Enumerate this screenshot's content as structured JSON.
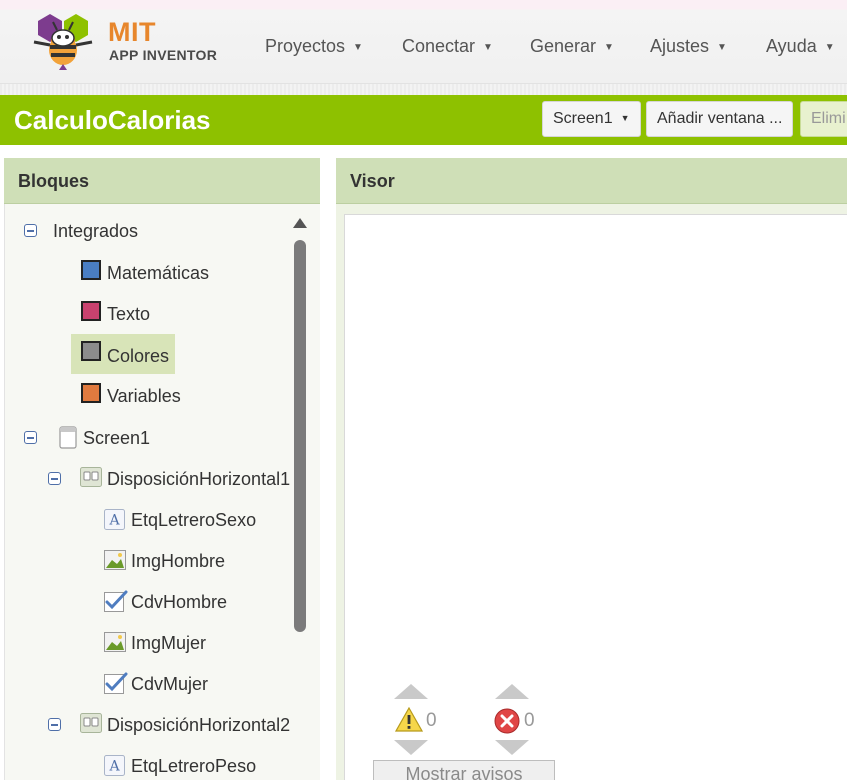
{
  "header": {
    "logo_mit": "MIT",
    "logo_app_inventor": "APP INVENTOR",
    "menu": [
      {
        "label": "Proyectos"
      },
      {
        "label": "Conectar"
      },
      {
        "label": "Generar"
      },
      {
        "label": "Ajustes"
      },
      {
        "label": "Ayuda"
      }
    ]
  },
  "project": {
    "title": "CalculoCalorias",
    "screen_select": "Screen1",
    "add_screen": "Añadir ventana ...",
    "remove_screen": "Elimi"
  },
  "blocks_panel": {
    "title": "Bloques",
    "tree": {
      "builtin": "Integrados",
      "math": "Matemáticas",
      "text": "Texto",
      "colors": "Colores",
      "variables": "Variables",
      "screen": "Screen1",
      "hlayout1": "DisposiciónHorizontal1",
      "label_sex": "EtqLetreroSexo",
      "img_man": "ImgHombre",
      "chk_man": "CdvHombre",
      "img_woman": "ImgMujer",
      "chk_woman": "CdvMujer",
      "hlayout2": "DisposiciónHorizontal2",
      "label_weight": "EtqLetreroPeso"
    }
  },
  "viewer_panel": {
    "title": "Visor",
    "warnings_count": "0",
    "errors_count": "0",
    "show_warnings": "Mostrar avisos"
  },
  "colors": {
    "project_bar": "#8ec100",
    "panel_header": "#cfdfb7",
    "math_block": "#4a7ec3",
    "text_block": "#c9426f",
    "color_block": "#8c8c8c",
    "variable_block": "#e07a3f"
  },
  "icons": {
    "component_icons": [
      "screen-icon",
      "horizontal-arrangement-icon",
      "label-icon",
      "image-icon",
      "checkbox-icon"
    ],
    "warnings": [
      "warning-icon",
      "error-icon"
    ]
  }
}
